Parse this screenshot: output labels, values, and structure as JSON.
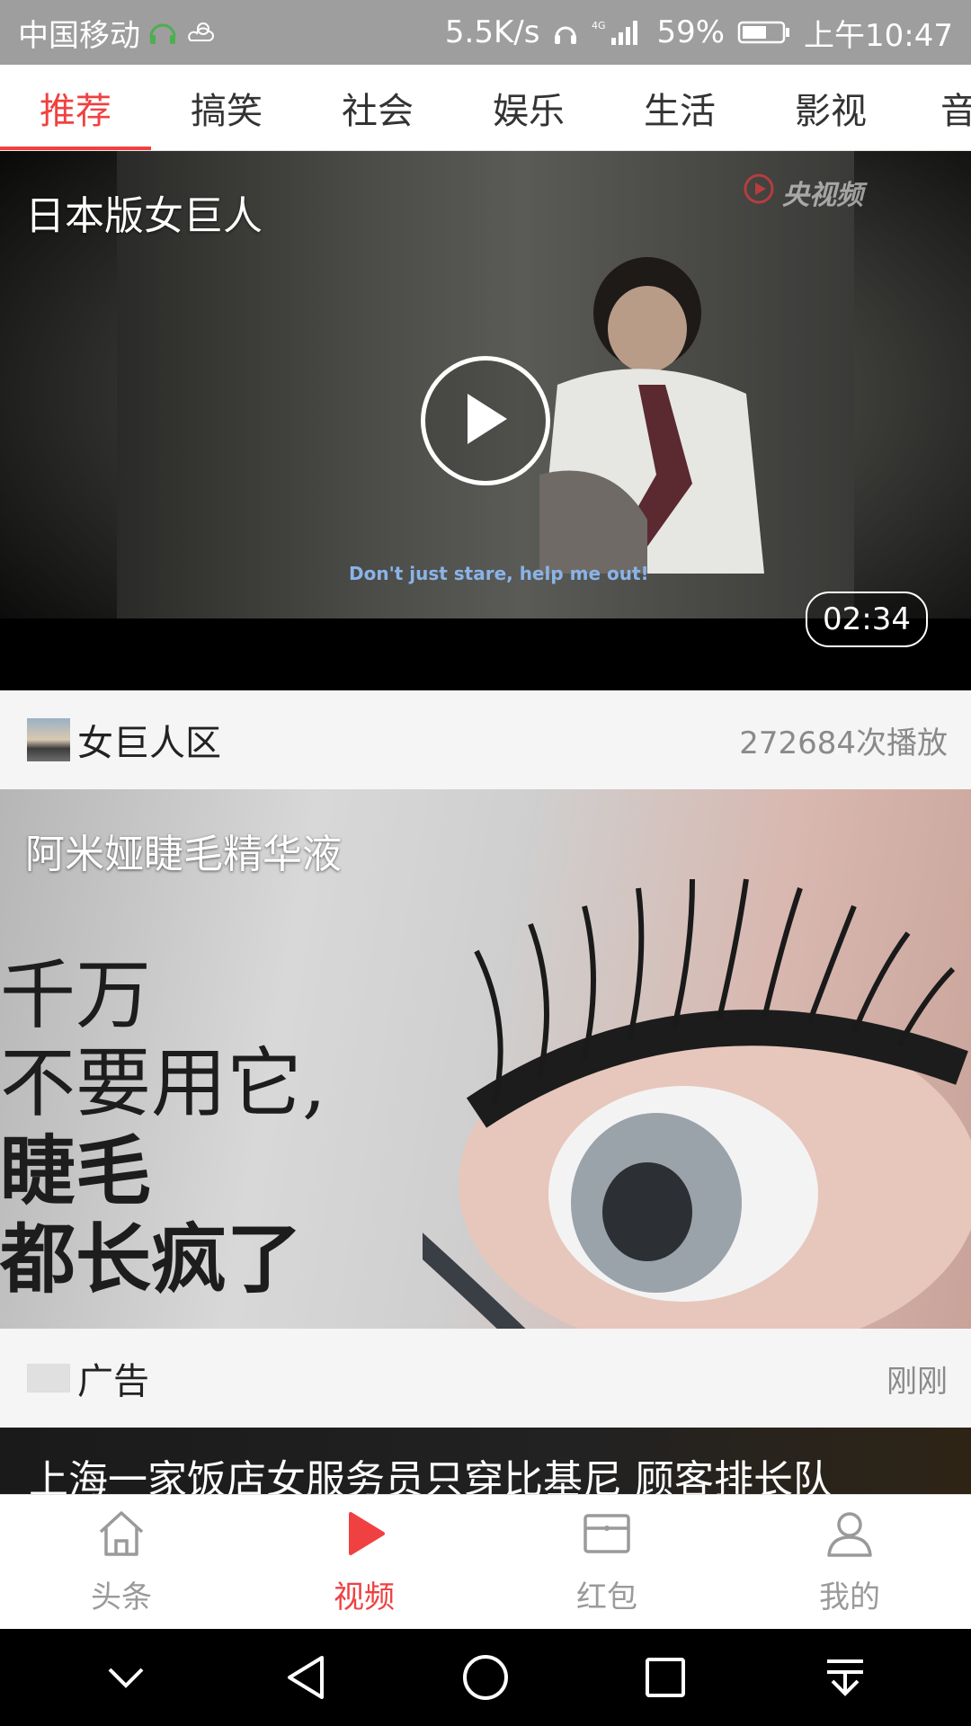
{
  "status_bar": {
    "carrier": "中国移动",
    "speed": "5.5K/s",
    "network": "4G",
    "battery": "59%",
    "time": "上午10:47"
  },
  "tabs": [
    {
      "label": "推荐",
      "active": true
    },
    {
      "label": "搞笑",
      "active": false
    },
    {
      "label": "社会",
      "active": false
    },
    {
      "label": "娱乐",
      "active": false
    },
    {
      "label": "生活",
      "active": false
    },
    {
      "label": "影视",
      "active": false
    },
    {
      "label": "音",
      "active": false
    }
  ],
  "feed": {
    "video_card": {
      "title": "日本版女巨人",
      "duration": "02:34",
      "subtitle_text": "Don't just stare, help me out!",
      "watermark": "央视频",
      "source": "女巨人区",
      "play_count": "272684次播放"
    },
    "ad_card": {
      "title": "阿米娅睫毛精华液",
      "ad_lines": [
        "千万",
        "不要用它,",
        "睫毛",
        "都长疯了"
      ],
      "source": "广告",
      "time": "刚刚"
    },
    "next_card": {
      "title": "上海一家饭店女服务员只穿比基尼 顾客排长队"
    }
  },
  "bottom_nav": [
    {
      "label": "头条",
      "icon": "home-icon",
      "active": false
    },
    {
      "label": "视频",
      "icon": "play-icon",
      "active": true
    },
    {
      "label": "红包",
      "icon": "red-envelope-icon",
      "active": false
    },
    {
      "label": "我的",
      "icon": "profile-icon",
      "active": false
    }
  ],
  "system_nav": [
    "chevron-down-icon",
    "back-icon",
    "home-circle-icon",
    "recents-icon",
    "download-icon"
  ],
  "colors": {
    "accent": "#f04142",
    "status_bar_bg": "#9e9e9e",
    "nav_inactive": "#9a9a9a"
  }
}
